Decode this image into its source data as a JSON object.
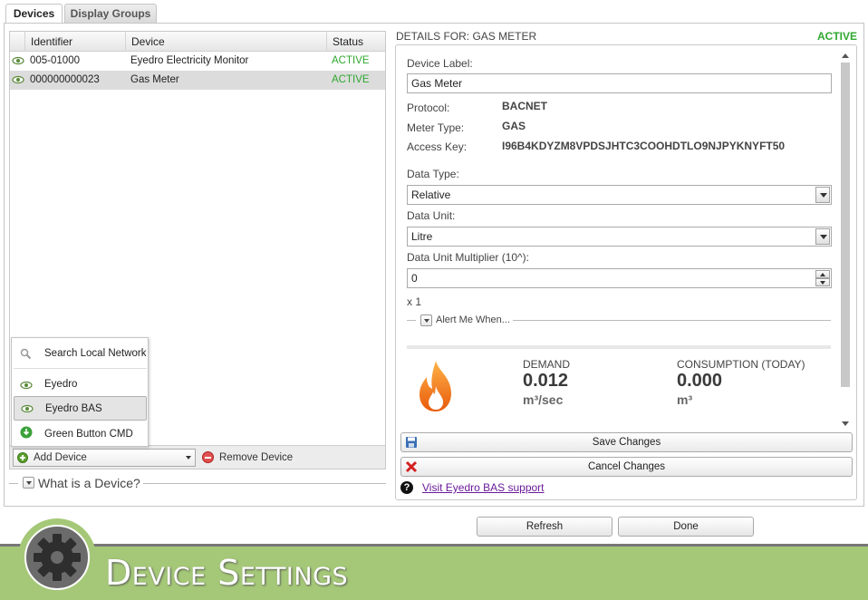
{
  "tabs": [
    {
      "label": "Devices",
      "active": true
    },
    {
      "label": "Display Groups",
      "active": false
    }
  ],
  "device_table": {
    "columns": [
      "Identifier",
      "Device",
      "Status"
    ],
    "rows": [
      {
        "identifier": "005-01000",
        "device": "Eyedro Electricity Monitor",
        "status": "ACTIVE",
        "selected": false
      },
      {
        "identifier": "000000000023",
        "device": "Gas Meter",
        "status": "ACTIVE",
        "selected": true
      }
    ]
  },
  "add_menu": {
    "items": [
      {
        "label": "Search Local Network",
        "icon": "magnifier-icon"
      },
      {
        "label": "Eyedro",
        "icon": "eye-icon"
      },
      {
        "label": "Eyedro BAS",
        "icon": "eye-icon"
      },
      {
        "label": "Green Button CMD",
        "icon": "green-download-icon"
      }
    ]
  },
  "toolbar": {
    "add_device": "Add Device",
    "remove_device": "Remove Device"
  },
  "what_is_device": "What is a Device?",
  "details": {
    "title": "DETAILS FOR: GAS METER",
    "status": "ACTIVE",
    "device_label_label": "Device Label:",
    "device_label_value": "Gas Meter",
    "protocol_label": "Protocol:",
    "protocol_value": "BACNET",
    "meter_type_label": "Meter Type:",
    "meter_type_value": "GAS",
    "access_key_label": "Access Key:",
    "access_key_value": "I96B4KDYZM8VPDSJHTC3COOHDTLO9NJPYKNYFT50",
    "data_type_label": "Data Type:",
    "data_type_value": "Relative",
    "data_unit_label": "Data Unit:",
    "data_unit_value": "Litre",
    "multiplier_label": "Data Unit Multiplier (10^):",
    "multiplier_value": "0",
    "multiplier_result": "x 1",
    "alert_label": "Alert Me When...",
    "demand_label": "DEMAND",
    "demand_value": "0.012",
    "demand_unit": "m³/sec",
    "consumption_label": "CONSUMPTION (TODAY)",
    "consumption_value": "0.000",
    "consumption_unit": "m³"
  },
  "actions": {
    "save": "Save Changes",
    "cancel": "Cancel Changes",
    "support_link": "Visit Eyedro BAS support",
    "refresh": "Refresh",
    "done": "Done"
  },
  "banner": {
    "title": "Device Settings"
  },
  "colors": {
    "active_green": "#2fa82f",
    "banner_green": "#a5c878",
    "flame_orange": "#f07c12"
  }
}
